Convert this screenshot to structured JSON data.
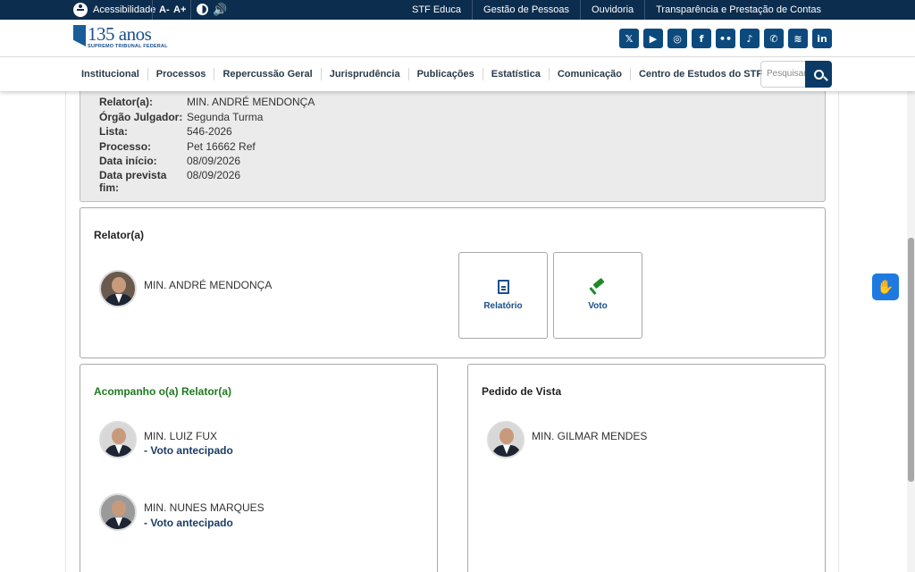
{
  "topbar": {
    "accessibility": "Acessibilidade",
    "font_decrease": "A-",
    "font_increase": "A+",
    "links": [
      "STF Educa",
      "Gestão de Pessoas",
      "Ouvidoria",
      "Transparência e Prestação de Contas"
    ]
  },
  "logo": {
    "main": "135 anos",
    "sub": "SUPREMO TRIBUNAL FEDERAL"
  },
  "socials": [
    {
      "name": "x-icon",
      "glyph": "𝕏"
    },
    {
      "name": "youtube-icon",
      "glyph": "▶"
    },
    {
      "name": "instagram-icon",
      "glyph": "◎"
    },
    {
      "name": "facebook-icon",
      "glyph": "f"
    },
    {
      "name": "flickr-icon",
      "glyph": "••"
    },
    {
      "name": "tiktok-icon",
      "glyph": "♪"
    },
    {
      "name": "whatsapp-icon",
      "glyph": "✆"
    },
    {
      "name": "spotify-icon",
      "glyph": "≋"
    },
    {
      "name": "linkedin-icon",
      "glyph": "in"
    }
  ],
  "nav": {
    "items": [
      "Institucional",
      "Processos",
      "Repercussão Geral",
      "Jurisprudência",
      "Publicações",
      "Estatística",
      "Comunicação",
      "Centro de Estudos do STF"
    ],
    "search_placeholder": "Pesquisar"
  },
  "info": {
    "rows": [
      {
        "label": "Relator(a):",
        "value": "MIN. ANDRÉ MENDONÇA"
      },
      {
        "label": "Órgão Julgador:",
        "value": "Segunda Turma"
      },
      {
        "label": "Lista:",
        "value": "546-2026"
      },
      {
        "label": "Processo:",
        "value": "Pet 16662 Ref"
      },
      {
        "label": "Data início:",
        "value": "08/09/2026"
      },
      {
        "label": "Data prevista fim:",
        "value": "08/09/2026"
      }
    ]
  },
  "relator_card": {
    "title": "Relator(a)",
    "minister": "MIN. ANDRÉ MENDONÇA",
    "buttons": [
      "Relatório",
      "Voto"
    ]
  },
  "acompanho_card": {
    "title": "Acompanho o(a) Relator(a)",
    "entries": [
      {
        "name": "MIN. LUIZ FUX",
        "note": "- Voto antecipado"
      },
      {
        "name": "MIN. NUNES MARQUES",
        "note": "- Voto antecipado"
      }
    ]
  },
  "vista_card": {
    "title": "Pedido de Vista",
    "entries": [
      {
        "name": "MIN. GILMAR MENDES"
      }
    ]
  },
  "colors": {
    "topbar": "#0c2d4e",
    "accent_blue": "#1a4f8b",
    "accent_green": "#1f7a1f"
  }
}
